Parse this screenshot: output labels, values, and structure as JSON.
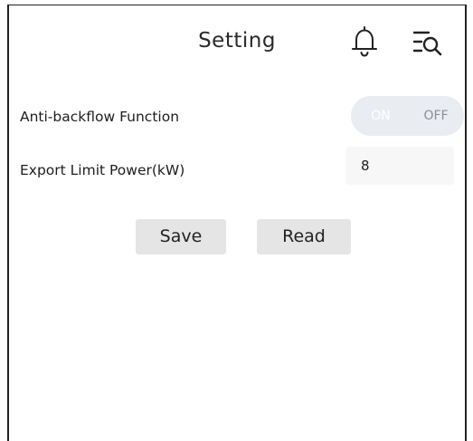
{
  "header": {
    "title": "Setting",
    "icons": [
      "bell-icon",
      "filter-list-search-icon"
    ]
  },
  "anti_backflow": {
    "label": "Anti-backflow Function",
    "toggle_on_label": "ON",
    "toggle_off_label": "OFF",
    "selected": "OFF"
  },
  "export_limit": {
    "label": "Export Limit Power(kW)",
    "value": "8"
  },
  "actions": {
    "save_label": "Save",
    "read_label": "Read"
  },
  "colors": {
    "toggle_bg": "#e9ecf1",
    "toggle_off_text": "#8a8f99",
    "button_bg": "#e5e5e5",
    "input_bg": "#f7f7f7"
  }
}
